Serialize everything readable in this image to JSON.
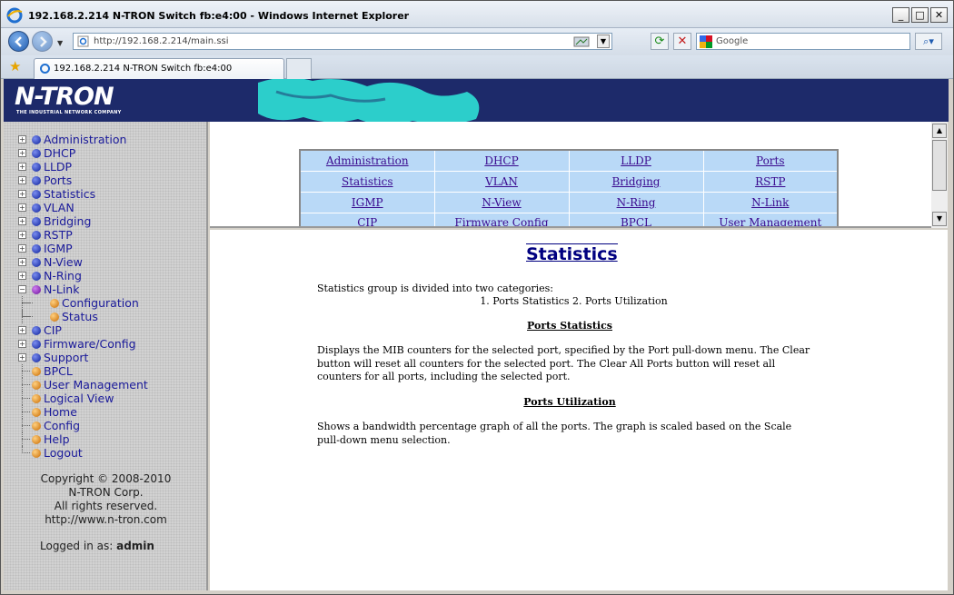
{
  "window": {
    "title": "192.168.2.214 N-TRON Switch fb:e4:00 - Windows Internet Explorer"
  },
  "address": {
    "url": "http://192.168.2.214/main.ssi"
  },
  "search": {
    "placeholder": "Google"
  },
  "tab": {
    "label": "192.168.2.214 N-TRON Switch fb:e4:00"
  },
  "banner": {
    "logo": "N-TRON",
    "tagline": "THE INDUSTRIAL NETWORK COMPANY"
  },
  "sidebar": {
    "items": [
      {
        "label": "Administration",
        "color": "blue",
        "expander": "+"
      },
      {
        "label": "DHCP",
        "color": "blue",
        "expander": "+"
      },
      {
        "label": "LLDP",
        "color": "blue",
        "expander": "+"
      },
      {
        "label": "Ports",
        "color": "blue",
        "expander": "+"
      },
      {
        "label": "Statistics",
        "color": "blue",
        "expander": "+"
      },
      {
        "label": "VLAN",
        "color": "blue",
        "expander": "+"
      },
      {
        "label": "Bridging",
        "color": "blue",
        "expander": "+"
      },
      {
        "label": "RSTP",
        "color": "blue",
        "expander": "+"
      },
      {
        "label": "IGMP",
        "color": "blue",
        "expander": "+"
      },
      {
        "label": "N-View",
        "color": "blue",
        "expander": "+"
      },
      {
        "label": "N-Ring",
        "color": "blue",
        "expander": "+"
      },
      {
        "label": "N-Link",
        "color": "purple",
        "expander": "-"
      },
      {
        "label": "Configuration",
        "color": "orange",
        "child": true
      },
      {
        "label": "Status",
        "color": "orange",
        "child": true,
        "last": true
      },
      {
        "label": "CIP",
        "color": "blue",
        "expander": "+"
      },
      {
        "label": "Firmware/Config",
        "color": "blue",
        "expander": "+"
      },
      {
        "label": "Support",
        "color": "blue",
        "expander": "+"
      },
      {
        "label": "BPCL",
        "color": "orange"
      },
      {
        "label": "User Management",
        "color": "orange"
      },
      {
        "label": "Logical View",
        "color": "orange"
      },
      {
        "label": "Home",
        "color": "orange"
      },
      {
        "label": "Config",
        "color": "orange"
      },
      {
        "label": "Help",
        "color": "orange"
      },
      {
        "label": "Logout",
        "color": "orange",
        "last": true
      }
    ],
    "copyright": [
      "Copyright © 2008-2010",
      "N-TRON Corp.",
      "All rights reserved.",
      "http://www.n-tron.com"
    ],
    "logged_label": "Logged in as:",
    "logged_user": "admin"
  },
  "nav_table": [
    [
      "Administration",
      "DHCP",
      "LLDP",
      "Ports"
    ],
    [
      "Statistics",
      "VLAN",
      "Bridging",
      "RSTP"
    ],
    [
      "IGMP",
      "N-View",
      "N-Ring",
      "N-Link"
    ],
    [
      "CIP",
      "Firmware Config",
      "BPCL",
      "User Management"
    ]
  ],
  "content": {
    "title": "Statistics",
    "intro": "Statistics group is divided into two categories:",
    "categories": "1. Ports Statistics   2. Ports Utilization",
    "sec1_title": "Ports Statistics",
    "sec1_text": "Displays the MIB counters for the selected port, specified by the Port pull-down menu. The Clear button will reset all counters for the selected port. The Clear All Ports button will reset all counters for all ports, including the selected port.",
    "sec2_title": "Ports Utilization",
    "sec2_text": "Shows a bandwidth percentage graph of all the ports. The graph is scaled based on the Scale pull-down menu selection."
  },
  "colors": {
    "sidebar_link": "#1a1a9a",
    "banner": "#1d2a6a",
    "nav_cell": "#b9d9f7",
    "title": "#000080"
  }
}
